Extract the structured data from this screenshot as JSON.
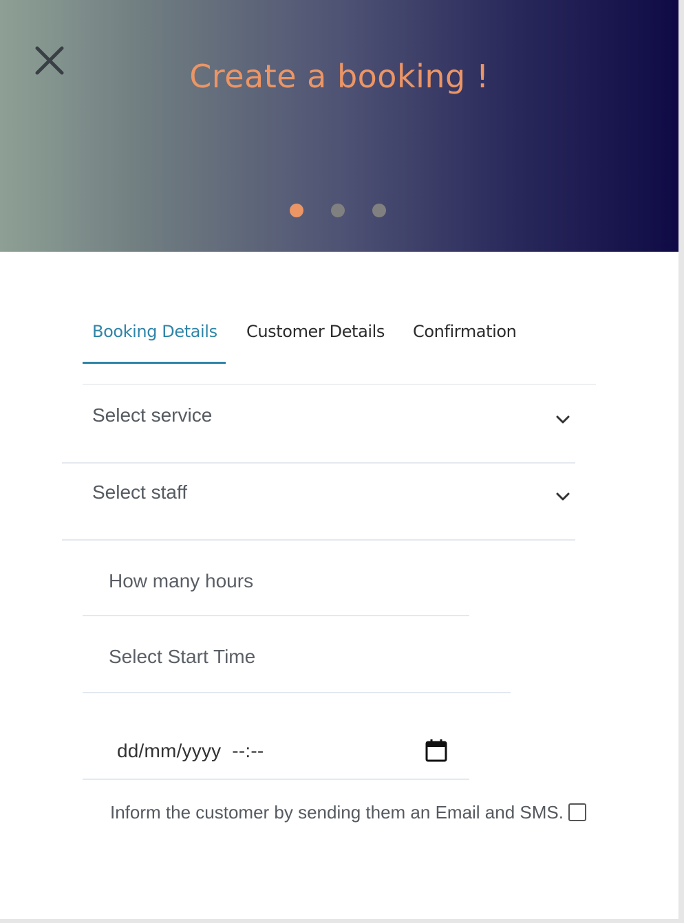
{
  "hero": {
    "title": "Create a booking !",
    "title_color": "#ec9565",
    "close_icon": "close-icon",
    "dots": [
      {
        "active": true,
        "color": "#ec9565"
      },
      {
        "active": false,
        "color": "#808080"
      },
      {
        "active": false,
        "color": "#808080"
      }
    ]
  },
  "tabs": {
    "items": [
      {
        "label": "Booking Details",
        "active": true
      },
      {
        "label": "Customer Details",
        "active": false
      },
      {
        "label": "Confirmation",
        "active": false
      }
    ],
    "active_color": "#2f85a8"
  },
  "form": {
    "service_placeholder": "Select service",
    "staff_placeholder": "Select staff",
    "hours_placeholder": "How many hours",
    "start_time_placeholder": "Select Start Time",
    "datetime_value": "dd/mm/yyyy  --:--",
    "dropdown_icon": "chevron-down-icon",
    "calendar_icon": "calendar-icon",
    "inform_label": "Inform the customer by sending them an Email and SMS.",
    "inform_checked": false
  }
}
